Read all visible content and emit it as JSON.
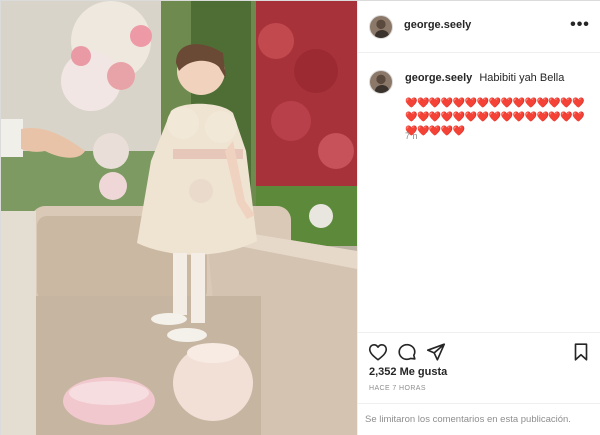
{
  "post": {
    "username": "george.seely",
    "more_icon": "more-horizontal-icon",
    "photo_alt": "Niña con vestido color crema de pie sobre un sofá",
    "caption": {
      "username": "george.seely",
      "text": "Habibiti yah Bella",
      "hearts": "❤️❤️❤️❤️❤️❤️❤️❤️❤️❤️❤️❤️❤️❤️❤️❤️❤️❤️❤️❤️❤️❤️❤️❤️❤️❤️❤️❤️❤️❤️❤️❤️❤️❤️❤️",
      "time": "7 h"
    },
    "actions": {
      "like_icon": "heart-outline-icon",
      "comment_icon": "comment-bubble-icon",
      "share_icon": "paper-plane-icon",
      "save_icon": "bookmark-icon"
    },
    "likes": "2,352 Me gusta",
    "posted_ago": "HACE 7 HORAS",
    "comments_limited": "Se limitaron los comentarios en esta publicación."
  }
}
